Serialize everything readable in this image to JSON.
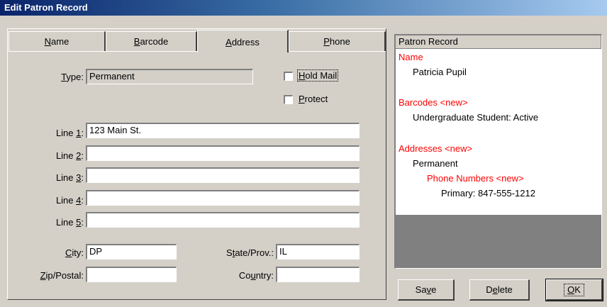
{
  "window": {
    "title": "Edit Patron Record"
  },
  "tabs": [
    {
      "label": "Name",
      "mn": "N",
      "rest": "ame"
    },
    {
      "label": "Barcode",
      "mn": "B",
      "rest": "arcode"
    },
    {
      "label": "Address",
      "mn": "A",
      "rest": "ddress"
    },
    {
      "label": "Phone",
      "mn": "P",
      "rest": "hone"
    }
  ],
  "active_tab": "Address",
  "address": {
    "type_label_mn": "T",
    "type_label_rest": "ype:",
    "type_value": "Permanent",
    "hold_mail_mn": "H",
    "hold_mail_rest": "old Mail",
    "protect_mn": "P",
    "protect_rest": "rotect",
    "lines": [
      {
        "pre": "Line ",
        "mn": "1",
        "post": ":",
        "value": "123 Main St."
      },
      {
        "pre": "Line ",
        "mn": "2",
        "post": ":",
        "value": ""
      },
      {
        "pre": "Line ",
        "mn": "3",
        "post": ":",
        "value": ""
      },
      {
        "pre": "Line ",
        "mn": "4",
        "post": ":",
        "value": ""
      },
      {
        "pre": "Line ",
        "mn": "5",
        "post": ":",
        "value": ""
      }
    ],
    "city_mn": "C",
    "city_rest": "ity:",
    "city_value": "DP",
    "state_pre": "S",
    "state_mn": "t",
    "state_rest": "ate/Prov.:",
    "state_value": "IL",
    "zip_mn": "Z",
    "zip_rest": "ip/Postal:",
    "zip_value": "",
    "country_pre": "Co",
    "country_mn": "u",
    "country_rest": "ntry:",
    "country_value": ""
  },
  "tree": {
    "header": "Patron Record",
    "name_heading": "Name",
    "name_value": "Patricia Pupil",
    "barcodes_heading": "Barcodes <new>",
    "barcode_value": "Undergraduate Student: Active",
    "addresses_heading": "Addresses <new>",
    "address_value": "Permanent",
    "phones_heading": "Phone Numbers <new>",
    "phone_value": "Primary: 847-555-1212"
  },
  "buttons": {
    "save_pre": "Sa",
    "save_mn": "v",
    "save_post": "e",
    "delete_pre": "D",
    "delete_mn": "e",
    "delete_post": "lete",
    "ok_mn": "O",
    "ok_post": "K"
  },
  "colors": {
    "heading_red": "#ff0000",
    "title_start": "#0a246a",
    "title_end": "#a6caf0"
  }
}
